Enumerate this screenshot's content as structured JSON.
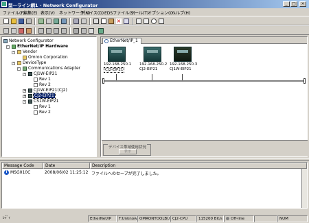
{
  "window": {
    "title": "型—ライン網1 - Network Configurator"
  },
  "menu": [
    "ファイル(F)",
    "編集(E)",
    "表示(V)",
    "ネットワーク(N)",
    "デバイス(D)",
    "EDSファイル(S)",
    "ツール(T)",
    "オプション(O)",
    "ヘルプ(H)"
  ],
  "toolbar1_icons": [
    "new-icon",
    "open-icon",
    "save-icon",
    "print-icon",
    "connect-icon",
    "disconnect-icon",
    "upload-icon",
    "download-icon",
    "monitor-icon",
    "compare-icon",
    "cut-icon",
    "copy-icon",
    "paste-icon",
    "delete-icon",
    "property-icon",
    "grid-icon",
    "list-icon",
    "zoom-icon",
    "table-icon"
  ],
  "toolbar2_icons": [
    "back-icon",
    "forward-icon",
    "device-icon",
    "parameter-icon",
    "network-icon",
    "tag-icon",
    "check-icon",
    "tree-icon",
    "export-icon",
    "import-icon",
    "settings-icon",
    "help-icon"
  ],
  "tree": [
    {
      "label": "Network Configurator",
      "level": 0,
      "icon": "computer-icon"
    },
    {
      "label": "EtherNet/IP Hardware",
      "level": 1,
      "icon": "network-icon",
      "bold": true
    },
    {
      "label": "Vendor",
      "level": 2,
      "icon": "folder-icon"
    },
    {
      "label": "Omron Corporation",
      "level": 3,
      "icon": "folder-icon"
    },
    {
      "label": "DeviceType",
      "level": 2,
      "icon": "folder-icon"
    },
    {
      "label": "Communications Adapter",
      "level": 3,
      "icon": "adapter-icon"
    },
    {
      "label": "CJ1W-EIP21",
      "level": 4,
      "icon": "device-icon"
    },
    {
      "label": "Rev 1",
      "level": 5,
      "icon": "doc-icon"
    },
    {
      "label": "Rev 2",
      "level": 5,
      "icon": "doc-icon"
    },
    {
      "label": "CJ1W-EIP21(CJ2)",
      "level": 4,
      "icon": "device-icon"
    },
    {
      "label": "CJ2-EIP21",
      "level": 4,
      "icon": "device-icon",
      "selected": true
    },
    {
      "label": "CS1W-EIP21",
      "level": 4,
      "icon": "device-icon"
    },
    {
      "label": "Rev 1",
      "level": 5,
      "icon": "doc-icon"
    },
    {
      "label": "Rev 2",
      "level": 5,
      "icon": "doc-icon"
    }
  ],
  "network": {
    "tab_label": "EtherNet/IP_1",
    "devices": [
      {
        "ip": "192.168.250.1",
        "name": "CJ2-EIP21",
        "selected": true
      },
      {
        "ip": "192.168.250.2",
        "name": "CJ2-EIP21"
      },
      {
        "ip": "192.168.250.3",
        "name": "CJ1W-EIP21"
      }
    ],
    "usage_group": "デバイス帯域使用状況",
    "usage_button": "表示"
  },
  "messages": {
    "columns": [
      "Message Code",
      "Date",
      "Description"
    ],
    "rows": [
      {
        "code": "MSG010C",
        "date": "2008/06/02 11:25:12",
        "description": "ファイルへのセーブが完了しました。"
      }
    ]
  },
  "status": {
    "left": "ﾚﾃﾞｨ",
    "network": "EtherNet/IP",
    "unit": "T:Unknown",
    "tool": "OMRONTOOLBUS",
    "cpu": "CJ2-CPU",
    "baud": "115200 Bit/s",
    "conn": "Off-line",
    "numlock": "NUM"
  },
  "colors": {
    "titlebar_start": "#0a246a",
    "titlebar_end": "#a6caf0",
    "selection": "#0a246a",
    "info": "#1e5ac8"
  }
}
